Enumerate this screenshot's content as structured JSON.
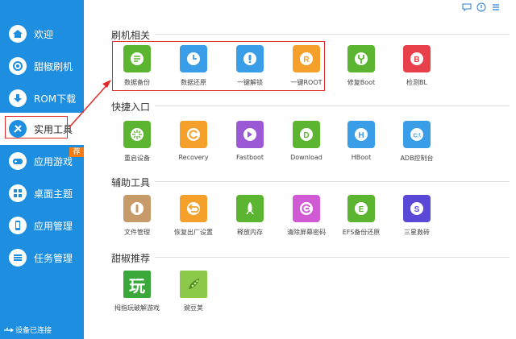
{
  "sidebar": {
    "items": [
      {
        "label": "欢迎",
        "icon": "home-icon"
      },
      {
        "label": "甜椒刷机",
        "icon": "flash-icon"
      },
      {
        "label": "ROM下载",
        "icon": "download-icon"
      },
      {
        "label": "实用工具",
        "icon": "tools-icon"
      },
      {
        "label": "应用游戏",
        "icon": "gamepad-icon"
      },
      {
        "label": "桌面主题",
        "icon": "grid-icon"
      },
      {
        "label": "应用管理",
        "icon": "phone-icon"
      },
      {
        "label": "任务管理",
        "icon": "list-icon"
      }
    ],
    "badge": "荐",
    "status": "设备已连接"
  },
  "window_controls": [
    "feedback-icon",
    "help-icon",
    "menu-icon"
  ],
  "sections": [
    {
      "title": "刷机相关",
      "tools": [
        {
          "label": "数据备份",
          "color": "#5cb531",
          "icon": "backup-icon"
        },
        {
          "label": "数据还原",
          "color": "#3a9de8",
          "icon": "clock-icon"
        },
        {
          "label": "一键解锁",
          "color": "#3a9de8",
          "icon": "unlock-icon"
        },
        {
          "label": "一键ROOT",
          "color": "#f5a02a",
          "icon": "root-icon"
        },
        {
          "label": "修复Boot",
          "color": "#5cb531",
          "icon": "wrench-icon"
        },
        {
          "label": "检测BL",
          "color": "#e8404a",
          "icon": "bl-icon"
        }
      ]
    },
    {
      "title": "快捷入口",
      "tools": [
        {
          "label": "重启设备",
          "color": "#5cb531",
          "icon": "restart-icon"
        },
        {
          "label": "Recovery",
          "color": "#f5a02a",
          "icon": "recovery-icon"
        },
        {
          "label": "Fastboot",
          "color": "#9b59d6",
          "icon": "fastboot-icon"
        },
        {
          "label": "Download",
          "color": "#5cb531",
          "icon": "download-mode-icon"
        },
        {
          "label": "HBoot",
          "color": "#3a9de8",
          "icon": "hboot-icon"
        },
        {
          "label": "ADB控制台",
          "color": "#3a9de8",
          "icon": "adb-icon"
        }
      ]
    },
    {
      "title": "辅助工具",
      "tools": [
        {
          "label": "文件管理",
          "color": "#c79a6a",
          "icon": "file-icon"
        },
        {
          "label": "恢复出厂设置",
          "color": "#f5a02a",
          "icon": "reset-icon"
        },
        {
          "label": "释放内存",
          "color": "#5cb531",
          "icon": "rocket-icon"
        },
        {
          "label": "清除屏幕密码",
          "color": "#d05ad3",
          "icon": "clear-password-icon"
        },
        {
          "label": "EFS备份还原",
          "color": "#5cb531",
          "icon": "efs-icon"
        },
        {
          "label": "三星救砖",
          "color": "#5a48d6",
          "icon": "samsung-icon"
        }
      ]
    },
    {
      "title": "甜椒推荐",
      "tools": [
        {
          "label": "拇指玩破解游戏",
          "color": "#3aa83a",
          "icon": "wan-icon",
          "glyph": "玩"
        },
        {
          "label": "豌豆荚",
          "color": "#8cc84a",
          "icon": "pea-icon"
        }
      ]
    }
  ]
}
